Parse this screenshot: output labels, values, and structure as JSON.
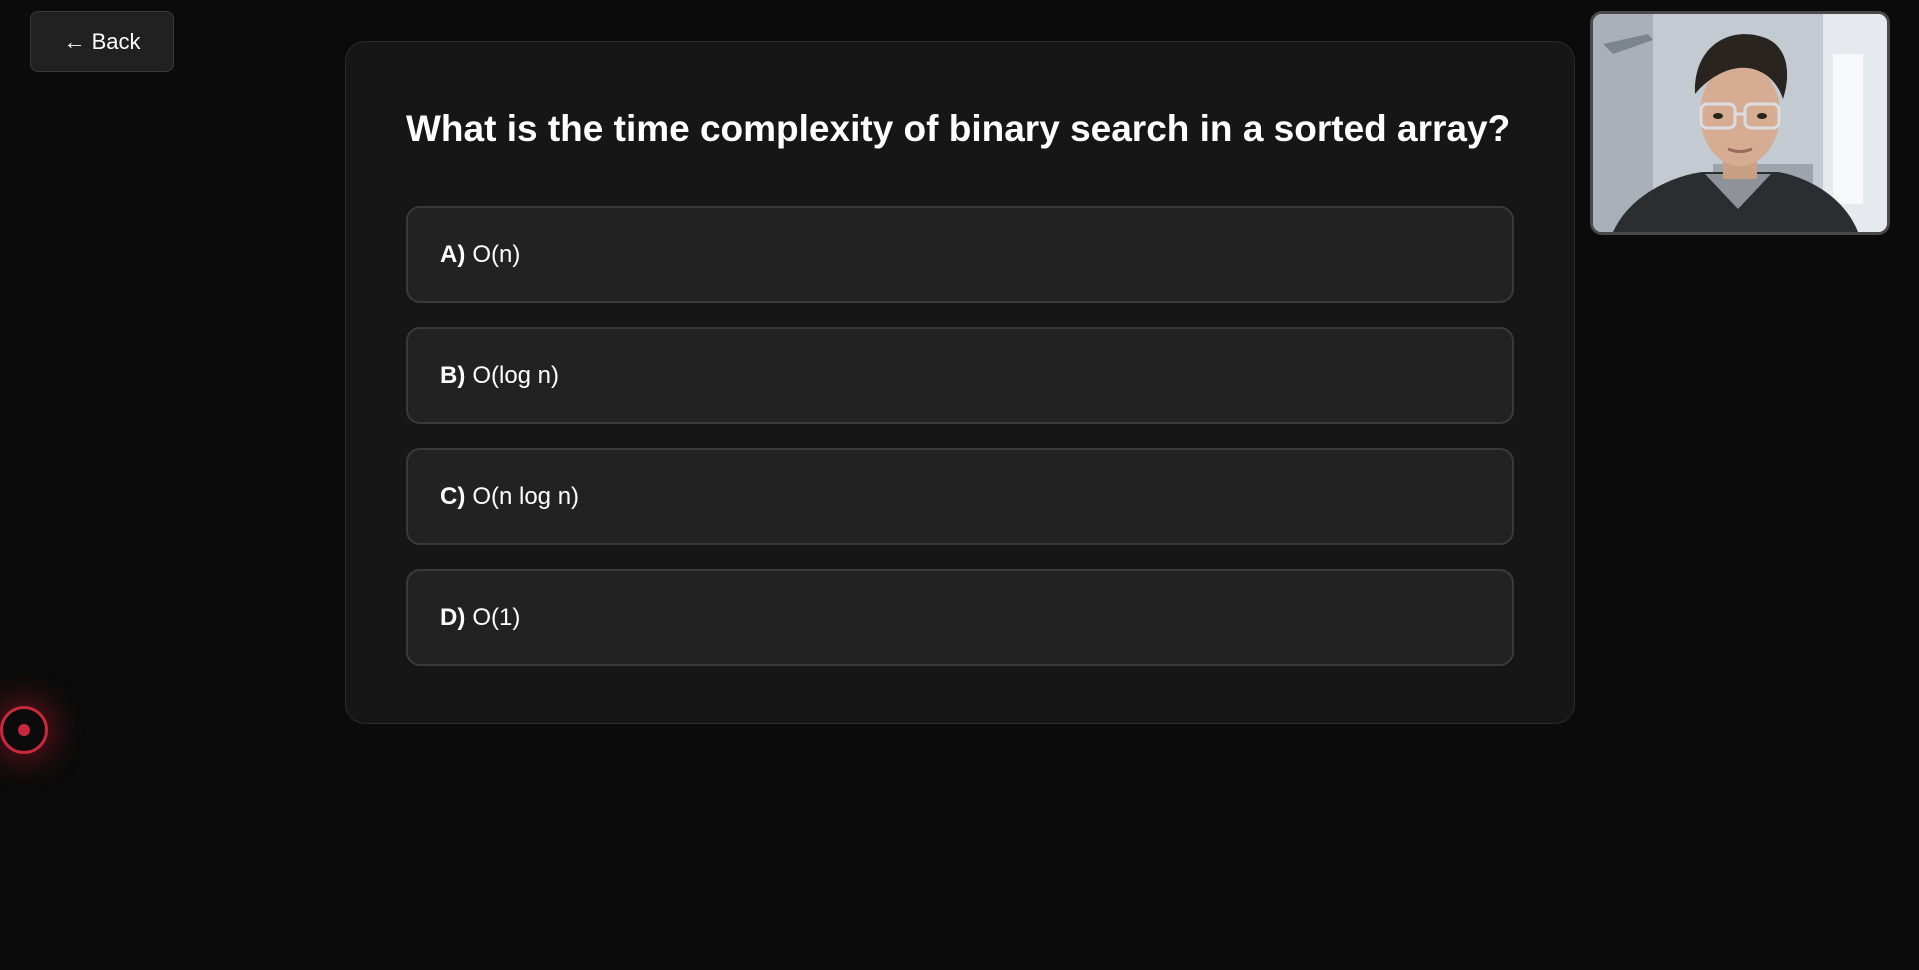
{
  "header": {
    "back_label": "← Back"
  },
  "quiz": {
    "question": "What is the time complexity of binary search in a sorted array?",
    "options": [
      {
        "letter": "A)",
        "text": "O(n)"
      },
      {
        "letter": "B)",
        "text": "O(log n)"
      },
      {
        "letter": "C)",
        "text": "O(n log n)"
      },
      {
        "letter": "D)",
        "text": "O(1)"
      }
    ]
  },
  "webcam": {
    "icon": "person-video-feed"
  },
  "recording": {
    "icon": "record-indicator-icon",
    "color": "#c8283c"
  },
  "colors": {
    "background": "#0b0b0b",
    "card": "#161616",
    "option": "#222222",
    "option_border": "#3a3a3a",
    "text": "#ffffff"
  }
}
